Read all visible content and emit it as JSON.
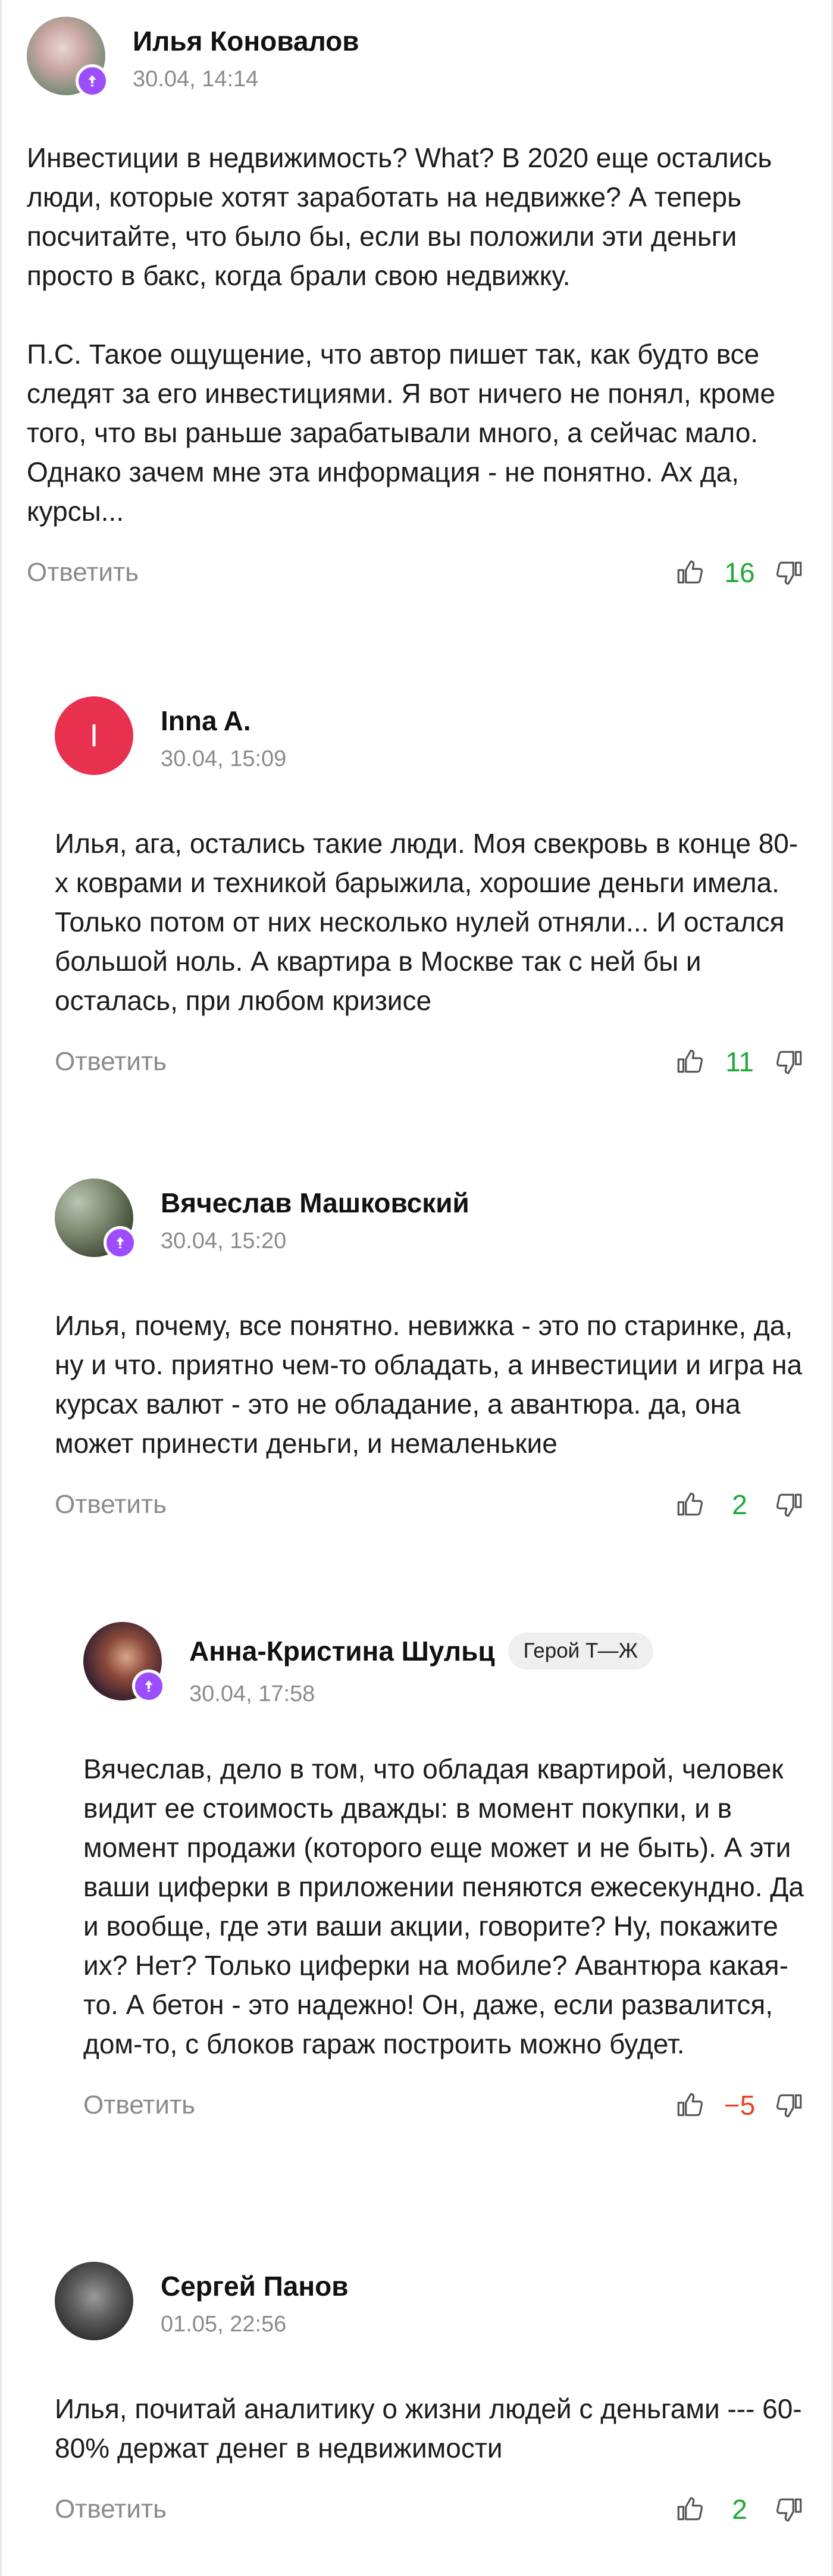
{
  "colors": {
    "positive": "#1ea838",
    "negative": "#e8432b",
    "badge": "#9b4dff",
    "muted": "#8b8b8b"
  },
  "comments": [
    {
      "author": "Илья Коновалов",
      "time": "30.04, 14:14",
      "text": "Инвестиции в недвижимость? What? В 2020 еще остались люди, которые хотят заработать на недвижке? А теперь посчитайте, что было бы, если вы положили эти деньги просто в бакс, когда брали свою недвижку.\n\nП.С. Такое ощущение, что автор пишет так, как будто все следят за его инвестициями. Я вот ничего не понял, кроме того, что вы раньше зарабатывали много, а сейчас мало. Однако зачем мне эта информация - не понятно. Ах да, курсы...",
      "reply_label": "Ответить",
      "score": "16"
    },
    {
      "author": "Inna A.",
      "avatar_letter": "I",
      "time": "30.04, 15:09",
      "text": "Илья, ага, остались такие люди. Моя свекровь в конце 80-х коврами и техникой барыжила, хорошие деньги имела. Только потом от них несколько нулей отняли... И остался большой ноль. А квартира в Москве так с ней бы и осталась, при любом кризисе",
      "reply_label": "Ответить",
      "score": "11"
    },
    {
      "author": "Вячеслав Машковский",
      "time": "30.04, 15:20",
      "text": "Илья, почему, все понятно. невижка - это по старинке, да, ну и что. приятно чем-то обладать, а инвестиции и игра на курсах валют - это не обладание, а авантюра. да, она может принести деньги, и немаленькие",
      "reply_label": "Ответить",
      "score": "2"
    },
    {
      "author": "Анна-Кристина Шульц",
      "tag": "Герой Т—Ж",
      "time": "30.04, 17:58",
      "text": "Вячеслав, дело в том, что обладая квартирой, человек видит ее стоимость дважды: в момент покупки, и в момент продажи (которого еще может и не быть). А эти ваши циферки в приложении пеняются ежесекундно. Да и вообще, где эти ваши акции, говорите? Ну, покажите их? Нет? Только циферки на мобиле? Авантюра какая-то. А бетон - это надежно! Он, даже, если развалится, дом-то, с блоков гараж построить можно будет.",
      "reply_label": "Ответить",
      "score": "−5"
    },
    {
      "author": "Сергей Панов",
      "time": "01.05, 22:56",
      "text": "Илья, почитай аналитику о жизни людей с деньгами --- 60-80% держат денег в недвижимости",
      "reply_label": "Ответить",
      "score": "2"
    }
  ]
}
